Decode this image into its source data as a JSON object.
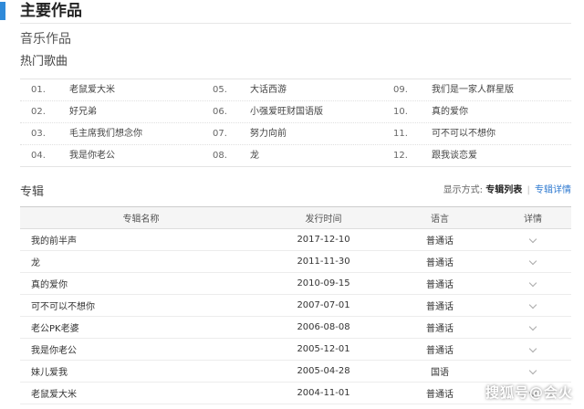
{
  "header": {
    "title": "主要作品",
    "accent_color": "#2f8ad9"
  },
  "music": {
    "subtitle": "音乐作品",
    "hot_label": "热门歌曲"
  },
  "songs": [
    [
      {
        "num": "01.",
        "name": "老鼠爱大米"
      },
      {
        "num": "05.",
        "name": "大话西游"
      },
      {
        "num": "09.",
        "name": "我们是一家人群星版"
      }
    ],
    [
      {
        "num": "02.",
        "name": "好兄弟"
      },
      {
        "num": "06.",
        "name": "小强爱旺财国语版"
      },
      {
        "num": "10.",
        "name": "真的爱你"
      }
    ],
    [
      {
        "num": "03.",
        "name": "毛主席我们想念你"
      },
      {
        "num": "07.",
        "name": "努力向前"
      },
      {
        "num": "11.",
        "name": "可不可以不想你"
      }
    ],
    [
      {
        "num": "04.",
        "name": "我是你老公"
      },
      {
        "num": "08.",
        "name": "龙"
      },
      {
        "num": "12.",
        "name": "跟我谈恋爱"
      }
    ]
  ],
  "albums_section": {
    "title": "专辑",
    "display_label": "显示方式:",
    "mode_active": "专辑列表",
    "separator": "|",
    "mode_other": "专辑详情"
  },
  "album_table": {
    "headers": {
      "name": "专辑名称",
      "date": "发行时间",
      "lang": "语言",
      "detail": "详情"
    },
    "rows": [
      {
        "name": "我的前半声",
        "date": "2017-12-10",
        "lang": "普通话"
      },
      {
        "name": "龙",
        "date": "2011-11-30",
        "lang": "普通话"
      },
      {
        "name": "真的爱你",
        "date": "2010-09-15",
        "lang": "普通话"
      },
      {
        "name": "可不可以不想你",
        "date": "2007-07-01",
        "lang": "普通话"
      },
      {
        "name": "老公PK老婆",
        "date": "2006-08-08",
        "lang": "普通话"
      },
      {
        "name": "我是你老公",
        "date": "2005-12-01",
        "lang": "普通话"
      },
      {
        "name": "妹儿爱我",
        "date": "2005-04-28",
        "lang": "国语"
      },
      {
        "name": "老鼠爱大米",
        "date": "2004-11-01",
        "lang": "普通话"
      }
    ]
  },
  "watermark": "搜狐号@会火"
}
